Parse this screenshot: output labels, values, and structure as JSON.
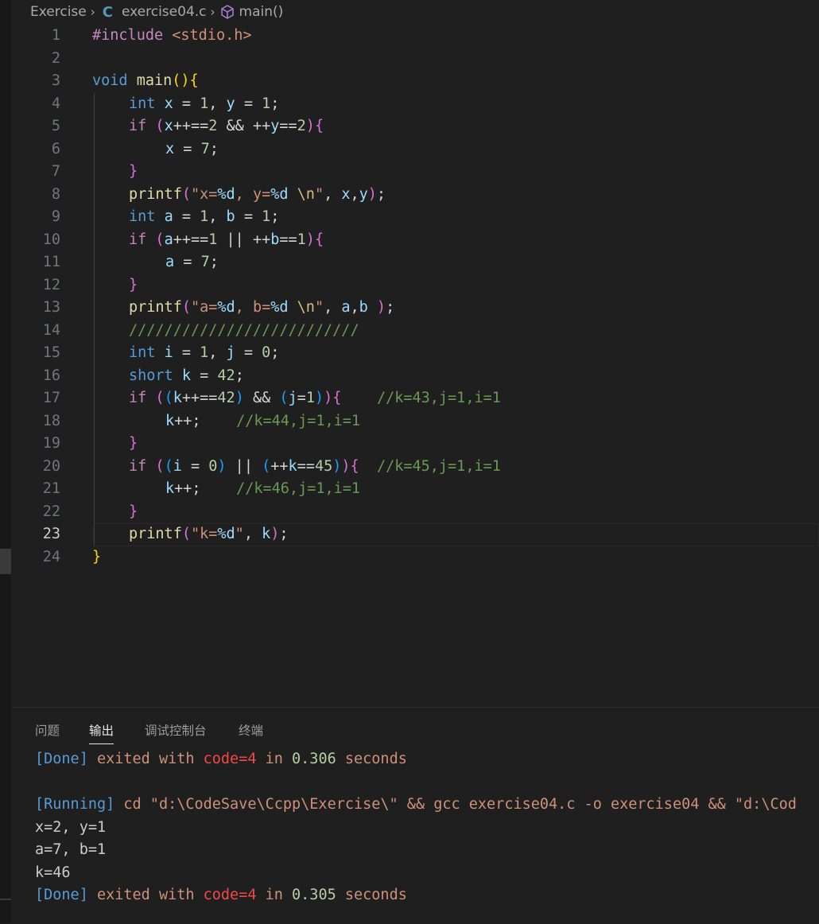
{
  "breadcrumb": {
    "folder": "Exercise",
    "file": "exercise04.c",
    "symbol": "main()"
  },
  "editor": {
    "current_line": 23,
    "lines": [
      {
        "n": "1",
        "indent": 0,
        "tokens": [
          [
            "ctl",
            "#include"
          ],
          [
            "op",
            " "
          ],
          [
            "str",
            "<stdio.h>"
          ]
        ]
      },
      {
        "n": "2",
        "indent": 0,
        "tokens": []
      },
      {
        "n": "3",
        "indent": 0,
        "tokens": [
          [
            "kw",
            "void"
          ],
          [
            "op",
            " "
          ],
          [
            "fn",
            "main"
          ],
          [
            "b1",
            "()"
          ],
          [
            "b1",
            "{"
          ]
        ]
      },
      {
        "n": "4",
        "indent": 1,
        "tokens": [
          [
            "kw",
            "int"
          ],
          [
            "op",
            " "
          ],
          [
            "var",
            "x"
          ],
          [
            "op",
            " = "
          ],
          [
            "num",
            "1"
          ],
          [
            "op",
            ", "
          ],
          [
            "var",
            "y"
          ],
          [
            "op",
            " = "
          ],
          [
            "num",
            "1"
          ],
          [
            "op",
            ";"
          ]
        ]
      },
      {
        "n": "5",
        "indent": 1,
        "tokens": [
          [
            "ctl",
            "if"
          ],
          [
            "op",
            " "
          ],
          [
            "b2",
            "("
          ],
          [
            "var",
            "x"
          ],
          [
            "op",
            "++=="
          ],
          [
            "num",
            "2"
          ],
          [
            "op",
            " && ++"
          ],
          [
            "var",
            "y"
          ],
          [
            "op",
            "=="
          ],
          [
            "num",
            "2"
          ],
          [
            "b2",
            ")"
          ],
          [
            "b2",
            "{"
          ]
        ]
      },
      {
        "n": "6",
        "indent": 2,
        "tokens": [
          [
            "var",
            "x"
          ],
          [
            "op",
            " = "
          ],
          [
            "num",
            "7"
          ],
          [
            "op",
            ";"
          ]
        ]
      },
      {
        "n": "7",
        "indent": 1,
        "tokens": [
          [
            "b2",
            "}"
          ]
        ]
      },
      {
        "n": "8",
        "indent": 1,
        "tokens": [
          [
            "fn",
            "printf"
          ],
          [
            "b2",
            "("
          ],
          [
            "str",
            "\"x="
          ],
          [
            "var",
            "%d"
          ],
          [
            "str",
            ", y="
          ],
          [
            "var",
            "%d"
          ],
          [
            "str",
            " "
          ],
          [
            "esc",
            "\\n"
          ],
          [
            "str",
            "\""
          ],
          [
            "op",
            ", "
          ],
          [
            "var",
            "x"
          ],
          [
            "op",
            ","
          ],
          [
            "var",
            "y"
          ],
          [
            "b2",
            ")"
          ],
          [
            "op",
            ";"
          ]
        ]
      },
      {
        "n": "9",
        "indent": 1,
        "tokens": [
          [
            "kw",
            "int"
          ],
          [
            "op",
            " "
          ],
          [
            "var",
            "a"
          ],
          [
            "op",
            " = "
          ],
          [
            "num",
            "1"
          ],
          [
            "op",
            ", "
          ],
          [
            "var",
            "b"
          ],
          [
            "op",
            " = "
          ],
          [
            "num",
            "1"
          ],
          [
            "op",
            ";"
          ]
        ]
      },
      {
        "n": "10",
        "indent": 1,
        "tokens": [
          [
            "ctl",
            "if"
          ],
          [
            "op",
            " "
          ],
          [
            "b2",
            "("
          ],
          [
            "var",
            "a"
          ],
          [
            "op",
            "++=="
          ],
          [
            "num",
            "1"
          ],
          [
            "op",
            " || ++"
          ],
          [
            "var",
            "b"
          ],
          [
            "op",
            "=="
          ],
          [
            "num",
            "1"
          ],
          [
            "b2",
            ")"
          ],
          [
            "b2",
            "{"
          ]
        ]
      },
      {
        "n": "11",
        "indent": 2,
        "tokens": [
          [
            "var",
            "a"
          ],
          [
            "op",
            " = "
          ],
          [
            "num",
            "7"
          ],
          [
            "op",
            ";"
          ]
        ]
      },
      {
        "n": "12",
        "indent": 1,
        "tokens": [
          [
            "b2",
            "}"
          ]
        ]
      },
      {
        "n": "13",
        "indent": 1,
        "tokens": [
          [
            "fn",
            "printf"
          ],
          [
            "b2",
            "("
          ],
          [
            "str",
            "\"a="
          ],
          [
            "var",
            "%d"
          ],
          [
            "str",
            ", b="
          ],
          [
            "var",
            "%d"
          ],
          [
            "str",
            " "
          ],
          [
            "esc",
            "\\n"
          ],
          [
            "str",
            "\""
          ],
          [
            "op",
            ", "
          ],
          [
            "var",
            "a"
          ],
          [
            "op",
            ","
          ],
          [
            "var",
            "b"
          ],
          [
            "op",
            " "
          ],
          [
            "b2",
            ")"
          ],
          [
            "op",
            ";"
          ]
        ]
      },
      {
        "n": "14",
        "indent": 1,
        "tokens": [
          [
            "cmt",
            "//////////////////////////"
          ]
        ]
      },
      {
        "n": "15",
        "indent": 1,
        "tokens": [
          [
            "kw",
            "int"
          ],
          [
            "op",
            " "
          ],
          [
            "var",
            "i"
          ],
          [
            "op",
            " = "
          ],
          [
            "num",
            "1"
          ],
          [
            "op",
            ", "
          ],
          [
            "var",
            "j"
          ],
          [
            "op",
            " = "
          ],
          [
            "num",
            "0"
          ],
          [
            "op",
            ";"
          ]
        ]
      },
      {
        "n": "16",
        "indent": 1,
        "tokens": [
          [
            "kw",
            "short"
          ],
          [
            "op",
            " "
          ],
          [
            "var",
            "k"
          ],
          [
            "op",
            " = "
          ],
          [
            "num",
            "42"
          ],
          [
            "op",
            ";"
          ]
        ]
      },
      {
        "n": "17",
        "indent": 1,
        "tokens": [
          [
            "ctl",
            "if"
          ],
          [
            "op",
            " "
          ],
          [
            "b2",
            "("
          ],
          [
            "b3",
            "("
          ],
          [
            "var",
            "k"
          ],
          [
            "op",
            "++=="
          ],
          [
            "num",
            "42"
          ],
          [
            "b3",
            ")"
          ],
          [
            "op",
            " && "
          ],
          [
            "b3",
            "("
          ],
          [
            "var",
            "j"
          ],
          [
            "op",
            "="
          ],
          [
            "num",
            "1"
          ],
          [
            "b3",
            ")"
          ],
          [
            "b2",
            ")"
          ],
          [
            "b2",
            "{"
          ],
          [
            "op",
            "    "
          ],
          [
            "cmt",
            "//k=43,j=1,i=1"
          ]
        ]
      },
      {
        "n": "18",
        "indent": 2,
        "tokens": [
          [
            "var",
            "k"
          ],
          [
            "op",
            "++;    "
          ],
          [
            "cmt",
            "//k=44,j=1,i=1"
          ]
        ]
      },
      {
        "n": "19",
        "indent": 1,
        "tokens": [
          [
            "b2",
            "}"
          ]
        ]
      },
      {
        "n": "20",
        "indent": 1,
        "tokens": [
          [
            "ctl",
            "if"
          ],
          [
            "op",
            " "
          ],
          [
            "b2",
            "("
          ],
          [
            "b3",
            "("
          ],
          [
            "var",
            "i"
          ],
          [
            "op",
            " = "
          ],
          [
            "num",
            "0"
          ],
          [
            "b3",
            ")"
          ],
          [
            "op",
            " || "
          ],
          [
            "b3",
            "("
          ],
          [
            "op",
            "++"
          ],
          [
            "var",
            "k"
          ],
          [
            "op",
            "=="
          ],
          [
            "num",
            "45"
          ],
          [
            "b3",
            ")"
          ],
          [
            "b2",
            ")"
          ],
          [
            "b2",
            "{"
          ],
          [
            "op",
            "  "
          ],
          [
            "cmt",
            "//k=45,j=1,i=1"
          ]
        ]
      },
      {
        "n": "21",
        "indent": 2,
        "tokens": [
          [
            "var",
            "k"
          ],
          [
            "op",
            "++;    "
          ],
          [
            "cmt",
            "//k=46,j=1,i=1"
          ]
        ]
      },
      {
        "n": "22",
        "indent": 1,
        "tokens": [
          [
            "b2",
            "}"
          ]
        ]
      },
      {
        "n": "23",
        "indent": 1,
        "tokens": [
          [
            "fn",
            "printf"
          ],
          [
            "b2",
            "("
          ],
          [
            "str",
            "\"k="
          ],
          [
            "var",
            "%d"
          ],
          [
            "str",
            "\""
          ],
          [
            "op",
            ", "
          ],
          [
            "var",
            "k"
          ],
          [
            "b2",
            ")"
          ],
          [
            "op",
            ";"
          ]
        ]
      },
      {
        "n": "24",
        "indent": 0,
        "tokens": [
          [
            "b1",
            "}"
          ]
        ]
      }
    ]
  },
  "panel": {
    "tabs": [
      {
        "label": "问题",
        "active": false
      },
      {
        "label": "输出",
        "active": true
      },
      {
        "label": "调试控制台",
        "active": false
      },
      {
        "label": "终端",
        "active": false
      }
    ],
    "output": [
      [
        [
          "o-tag",
          "[Done]"
        ],
        [
          "o-plain",
          " "
        ],
        [
          "o-kw",
          "exited"
        ],
        [
          "o-plain",
          " "
        ],
        [
          "o-kw",
          "with"
        ],
        [
          "o-plain",
          " "
        ],
        [
          "o-code",
          "code=4"
        ],
        [
          "o-plain",
          " "
        ],
        [
          "o-kw",
          "in"
        ],
        [
          "o-plain",
          " "
        ],
        [
          "o-num",
          "0.306"
        ],
        [
          "o-plain",
          " "
        ],
        [
          "o-kw",
          "seconds"
        ]
      ],
      [],
      [
        [
          "o-tag",
          "[Running]"
        ],
        [
          "o-plain",
          " "
        ],
        [
          "o-cmd",
          "cd \"d:\\CodeSave\\Ccpp\\Exercise\\\" && gcc exercise04.c -o exercise04 && \"d:\\Cod"
        ]
      ],
      [
        [
          "o-plain",
          "x=2, y=1"
        ]
      ],
      [
        [
          "o-plain",
          "a=7, b=1"
        ]
      ],
      [
        [
          "o-plain",
          "k=46"
        ]
      ],
      [
        [
          "o-tag",
          "[Done]"
        ],
        [
          "o-plain",
          " "
        ],
        [
          "o-kw",
          "exited"
        ],
        [
          "o-plain",
          " "
        ],
        [
          "o-kw",
          "with"
        ],
        [
          "o-plain",
          " "
        ],
        [
          "o-code",
          "code=4"
        ],
        [
          "o-plain",
          " "
        ],
        [
          "o-kw",
          "in"
        ],
        [
          "o-plain",
          " "
        ],
        [
          "o-num",
          "0.305"
        ],
        [
          "o-plain",
          " "
        ],
        [
          "o-kw",
          "seconds"
        ]
      ]
    ]
  },
  "icons": {
    "c_file": "c-file-icon",
    "symbol": "cube-icon",
    "separator": "chevron-right-icon"
  },
  "colors": {
    "background": "#1f1f1f",
    "keyword": "#569cd6",
    "control": "#c586c0",
    "function": "#dcdcaa",
    "string": "#ce9178",
    "number": "#b5cea8",
    "variable": "#9cdcfe",
    "comment": "#6a9955"
  }
}
